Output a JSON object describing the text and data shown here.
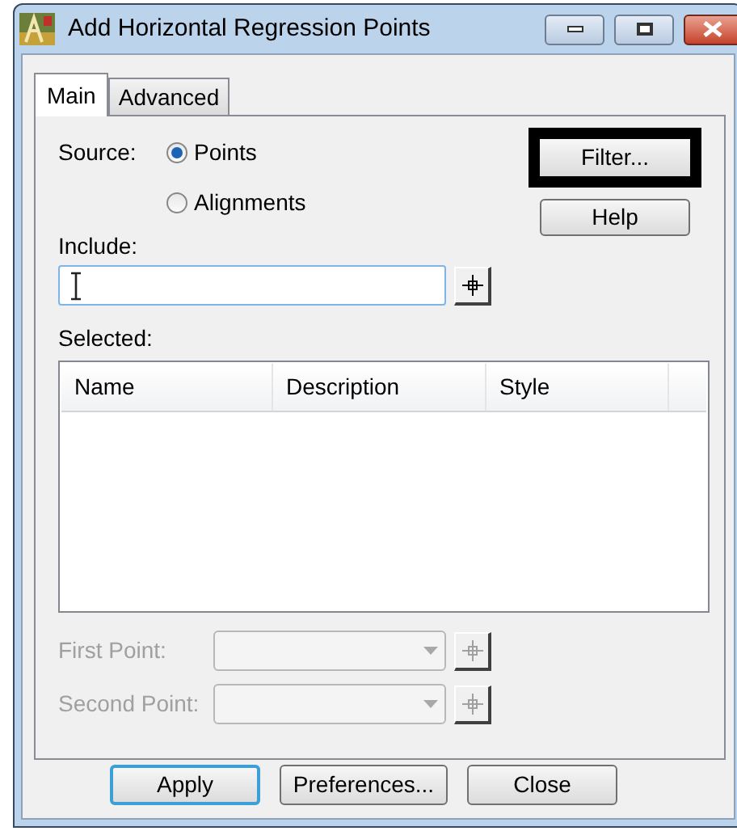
{
  "window": {
    "title": "Add Horizontal Regression Points"
  },
  "tabs": [
    {
      "label": "Main",
      "selected": true
    },
    {
      "label": "Advanced",
      "selected": false
    }
  ],
  "source": {
    "label": "Source:",
    "options": [
      {
        "label": "Points",
        "selected": true
      },
      {
        "label": "Alignments",
        "selected": false
      }
    ]
  },
  "side_buttons": [
    {
      "label": "Filter...",
      "highlighted": true
    },
    {
      "label": "Help",
      "highlighted": false
    }
  ],
  "include": {
    "label": "Include:",
    "focused": true
  },
  "selected": {
    "label": "Selected:",
    "columns": [
      "Name",
      "Description",
      "Style"
    ]
  },
  "point_fields": [
    {
      "label": "First Point:",
      "disabled": true
    },
    {
      "label": "Second Point:",
      "disabled": true
    }
  ],
  "buttons": [
    {
      "label": "Apply",
      "default": true
    },
    {
      "label": "Preferences...",
      "default": false
    },
    {
      "label": "Close",
      "default": false
    }
  ]
}
